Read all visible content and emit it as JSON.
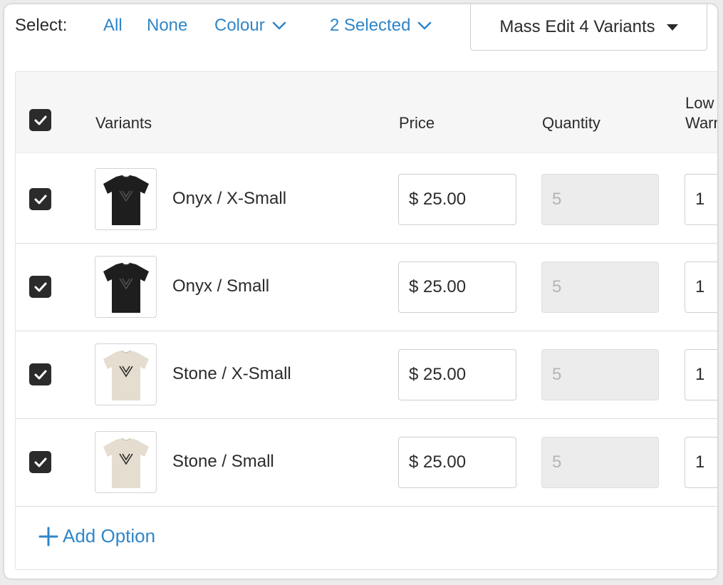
{
  "select_bar": {
    "label": "Select:",
    "all": "All",
    "none": "None",
    "colour": "Colour",
    "selected": "2 Selected",
    "mass_edit": "Mass Edit 4 Variants"
  },
  "table": {
    "headers": {
      "variants": "Variants",
      "price": "Price",
      "quantity": "Quantity",
      "low_line1": "Low",
      "low_line2": "Warn"
    },
    "rows": [
      {
        "name": "Onyx / X-Small",
        "price": "$ 25.00",
        "quantity": "5",
        "low": "1",
        "checked": true,
        "shirt_color": "black"
      },
      {
        "name": "Onyx / Small",
        "price": "$ 25.00",
        "quantity": "5",
        "low": "1",
        "checked": true,
        "shirt_color": "black"
      },
      {
        "name": "Stone / X-Small",
        "price": "$ 25.00",
        "quantity": "5",
        "low": "1",
        "checked": true,
        "shirt_color": "stone"
      },
      {
        "name": "Stone / Small",
        "price": "$ 25.00",
        "quantity": "5",
        "low": "1",
        "checked": true,
        "shirt_color": "stone"
      }
    ]
  },
  "add_option": "Add Option",
  "colors": {
    "link": "#2f86c8",
    "checkbox": "#2b2b2b",
    "shirt_black": "#1e1e1e",
    "shirt_stone": "#e4ddd0"
  }
}
